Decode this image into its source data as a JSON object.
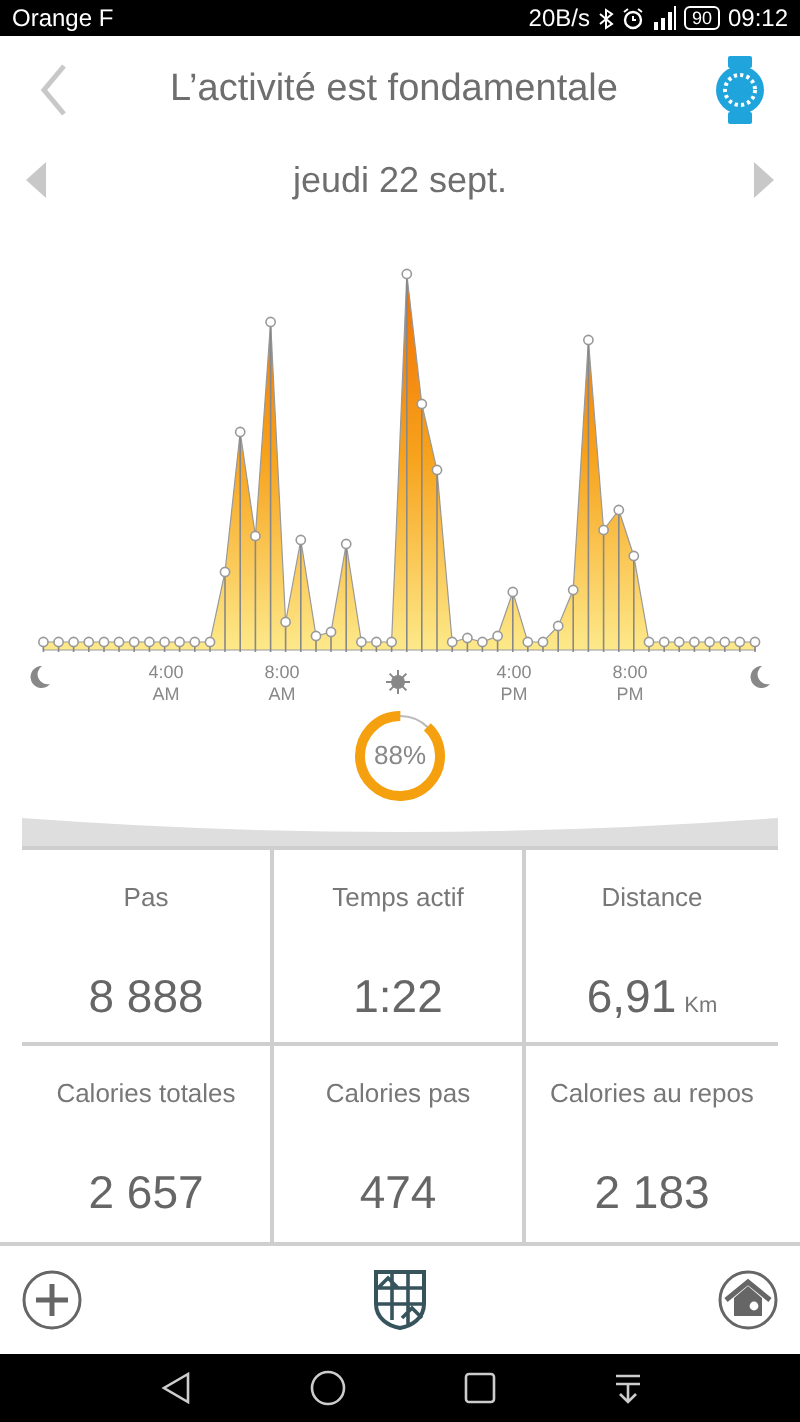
{
  "status_bar": {
    "carrier": "Orange F",
    "speed": "20B/s",
    "battery": "90",
    "time": "09:12"
  },
  "header": {
    "title": "L’activité est fondamentale"
  },
  "date_nav": {
    "date": "jeudi 22 sept."
  },
  "axis_labels": [
    {
      "time": "4:00",
      "period": "AM"
    },
    {
      "time": "8:00",
      "period": "AM"
    },
    {
      "time": "4:00",
      "period": "PM"
    },
    {
      "time": "8:00",
      "period": "PM"
    }
  ],
  "goal": {
    "label": "88%",
    "level": 0.88
  },
  "stats": [
    {
      "label": "Pas",
      "value": "8 888"
    },
    {
      "label": "Temps actif",
      "value": "1:22"
    },
    {
      "label": "Distance",
      "value": "6,91",
      "unit": "Km"
    },
    {
      "label": "Calories totales",
      "value": "2 657"
    },
    {
      "label": "Calories pas",
      "value": "474"
    },
    {
      "label": "Calories au repos",
      "value": "2 183"
    }
  ]
}
